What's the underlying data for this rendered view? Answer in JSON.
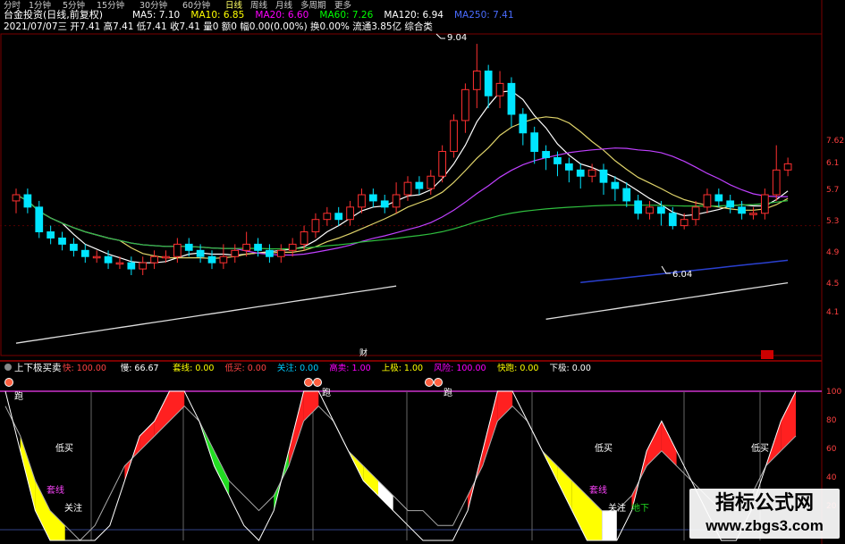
{
  "toolbar": {
    "periods": [
      "分时",
      "1分钟",
      "5分钟",
      "15分钟",
      "30分钟",
      "60分钟",
      "日线",
      "周线",
      "月线",
      "多周期",
      "更多"
    ],
    "active": "日线"
  },
  "main_chart": {
    "title": "台金投资(日线,前复权)",
    "ma_legend": [
      {
        "label": "MA5: 7.10",
        "color": "#ffffff"
      },
      {
        "label": "MA10: 6.85",
        "color": "#ffff00"
      },
      {
        "label": "MA20: 6.60",
        "color": "#ff00ff"
      },
      {
        "label": "MA60: 7.26",
        "color": "#00ff00"
      },
      {
        "label": "MA120: 6.94",
        "color": "#ffffff"
      },
      {
        "label": "MA250: 7.41",
        "color": "#4a6cff"
      }
    ],
    "info_line": "2021/07/07三 开7.41 高7.41 低7.41 收7.41 量0 额0 幅0.00(0.00%) 换0.00% 流通3.85亿 综合类",
    "high_label": "9.04",
    "low_label": "6.04",
    "right_axis": [
      "7.62",
      "6.1",
      "5.7",
      "5.3",
      "4.9",
      "4.5",
      "4.1"
    ],
    "x_axis_label": "财"
  },
  "indicator": {
    "title": "上下极买卖",
    "values": [
      {
        "label": "快: 100.00",
        "color": "#ff4444"
      },
      {
        "label": "慢: 66.67",
        "color": "#ffffff"
      },
      {
        "label": "套线: 0.00",
        "color": "#ffff00"
      },
      {
        "label": "低买: 0.00",
        "color": "#ff4444"
      },
      {
        "label": "关注: 0.00",
        "color": "#00ccff"
      },
      {
        "label": "高卖: 1.00",
        "color": "#ff00ff"
      },
      {
        "label": "上极: 1.00",
        "color": "#ffff00"
      },
      {
        "label": "风险: 100.00",
        "color": "#ff00ff"
      },
      {
        "label": "快跑: 0.00",
        "color": "#ffff00"
      },
      {
        "label": "下极: 0.00",
        "color": "#ffffff"
      }
    ],
    "right_axis": [
      "100",
      "80",
      "60",
      "40",
      "20"
    ],
    "labels": {
      "run": "跑",
      "buy_low": "低买",
      "trap": "套线",
      "watch": "关注",
      "bottom": "地下"
    }
  },
  "watermark": {
    "title": "指标公式网",
    "url": "www.zbgs3.com"
  },
  "chart_data": [
    {
      "type": "candlestick",
      "title": "台金投资(日线,前复权)",
      "candles": [
        {
          "o": 6.5,
          "c": 6.6,
          "h": 6.7,
          "l": 6.3
        },
        {
          "o": 6.6,
          "c": 6.4,
          "h": 6.7,
          "l": 6.3
        },
        {
          "o": 6.4,
          "c": 6.0,
          "h": 6.5,
          "l": 5.9
        },
        {
          "o": 6.0,
          "c": 5.9,
          "h": 6.1,
          "l": 5.8
        },
        {
          "o": 5.9,
          "c": 5.8,
          "h": 6.0,
          "l": 5.7
        },
        {
          "o": 5.8,
          "c": 5.7,
          "h": 5.9,
          "l": 5.6
        },
        {
          "o": 5.7,
          "c": 5.6,
          "h": 5.8,
          "l": 5.5
        },
        {
          "o": 5.6,
          "c": 5.6,
          "h": 5.7,
          "l": 5.5
        },
        {
          "o": 5.6,
          "c": 5.5,
          "h": 5.7,
          "l": 5.4
        },
        {
          "o": 5.5,
          "c": 5.5,
          "h": 5.6,
          "l": 5.4
        },
        {
          "o": 5.5,
          "c": 5.4,
          "h": 5.6,
          "l": 5.3
        },
        {
          "o": 5.4,
          "c": 5.5,
          "h": 5.6,
          "l": 5.3
        },
        {
          "o": 5.5,
          "c": 5.6,
          "h": 5.7,
          "l": 5.4
        },
        {
          "o": 5.6,
          "c": 5.6,
          "h": 5.7,
          "l": 5.5
        },
        {
          "o": 5.6,
          "c": 5.8,
          "h": 5.9,
          "l": 5.5
        },
        {
          "o": 5.8,
          "c": 5.7,
          "h": 5.9,
          "l": 5.6
        },
        {
          "o": 5.7,
          "c": 5.6,
          "h": 5.8,
          "l": 5.5
        },
        {
          "o": 5.6,
          "c": 5.5,
          "h": 5.7,
          "l": 5.4
        },
        {
          "o": 5.5,
          "c": 5.6,
          "h": 5.8,
          "l": 5.4
        },
        {
          "o": 5.6,
          "c": 5.7,
          "h": 5.8,
          "l": 5.5
        },
        {
          "o": 5.7,
          "c": 5.8,
          "h": 6.0,
          "l": 5.6
        },
        {
          "o": 5.8,
          "c": 5.7,
          "h": 5.9,
          "l": 5.6
        },
        {
          "o": 5.7,
          "c": 5.6,
          "h": 5.8,
          "l": 5.5
        },
        {
          "o": 5.6,
          "c": 5.7,
          "h": 5.8,
          "l": 5.5
        },
        {
          "o": 5.7,
          "c": 5.8,
          "h": 5.9,
          "l": 5.6
        },
        {
          "o": 5.8,
          "c": 6.0,
          "h": 6.1,
          "l": 5.7
        },
        {
          "o": 6.0,
          "c": 6.2,
          "h": 6.3,
          "l": 5.9
        },
        {
          "o": 6.2,
          "c": 6.3,
          "h": 6.4,
          "l": 6.1
        },
        {
          "o": 6.3,
          "c": 6.2,
          "h": 6.4,
          "l": 6.1
        },
        {
          "o": 6.2,
          "c": 6.4,
          "h": 6.5,
          "l": 6.1
        },
        {
          "o": 6.4,
          "c": 6.6,
          "h": 6.7,
          "l": 6.3
        },
        {
          "o": 6.6,
          "c": 6.5,
          "h": 6.7,
          "l": 6.4
        },
        {
          "o": 6.5,
          "c": 6.4,
          "h": 6.6,
          "l": 6.3
        },
        {
          "o": 6.4,
          "c": 6.6,
          "h": 6.8,
          "l": 6.3
        },
        {
          "o": 6.6,
          "c": 6.8,
          "h": 6.9,
          "l": 6.5
        },
        {
          "o": 6.8,
          "c": 6.7,
          "h": 6.9,
          "l": 6.6
        },
        {
          "o": 6.7,
          "c": 6.9,
          "h": 7.0,
          "l": 6.6
        },
        {
          "o": 6.9,
          "c": 7.3,
          "h": 7.4,
          "l": 6.8
        },
        {
          "o": 7.3,
          "c": 7.8,
          "h": 7.9,
          "l": 7.2
        },
        {
          "o": 7.8,
          "c": 8.3,
          "h": 8.4,
          "l": 7.6
        },
        {
          "o": 8.3,
          "c": 8.6,
          "h": 9.04,
          "l": 8.0
        },
        {
          "o": 8.6,
          "c": 8.2,
          "h": 8.7,
          "l": 8.0
        },
        {
          "o": 8.2,
          "c": 8.4,
          "h": 8.6,
          "l": 8.0
        },
        {
          "o": 8.4,
          "c": 7.9,
          "h": 8.5,
          "l": 7.7
        },
        {
          "o": 7.9,
          "c": 7.6,
          "h": 8.0,
          "l": 7.4
        },
        {
          "o": 7.6,
          "c": 7.3,
          "h": 7.7,
          "l": 7.1
        },
        {
          "o": 7.3,
          "c": 7.2,
          "h": 7.4,
          "l": 7.0
        },
        {
          "o": 7.2,
          "c": 7.1,
          "h": 7.3,
          "l": 6.9
        },
        {
          "o": 7.1,
          "c": 7.0,
          "h": 7.2,
          "l": 6.8
        },
        {
          "o": 7.0,
          "c": 6.9,
          "h": 7.1,
          "l": 6.7
        },
        {
          "o": 6.9,
          "c": 7.0,
          "h": 7.1,
          "l": 6.8
        },
        {
          "o": 7.0,
          "c": 6.8,
          "h": 7.1,
          "l": 6.6
        },
        {
          "o": 6.8,
          "c": 6.7,
          "h": 6.9,
          "l": 6.5
        },
        {
          "o": 6.7,
          "c": 6.5,
          "h": 6.8,
          "l": 6.4
        },
        {
          "o": 6.5,
          "c": 6.3,
          "h": 6.6,
          "l": 6.2
        },
        {
          "o": 6.3,
          "c": 6.4,
          "h": 6.5,
          "l": 6.2
        },
        {
          "o": 6.4,
          "c": 6.3,
          "h": 6.5,
          "l": 6.1
        },
        {
          "o": 6.3,
          "c": 6.1,
          "h": 6.4,
          "l": 6.04
        },
        {
          "o": 6.1,
          "c": 6.2,
          "h": 6.3,
          "l": 6.04
        },
        {
          "o": 6.2,
          "c": 6.4,
          "h": 6.5,
          "l": 6.1
        },
        {
          "o": 6.4,
          "c": 6.6,
          "h": 6.7,
          "l": 6.3
        },
        {
          "o": 6.6,
          "c": 6.5,
          "h": 6.7,
          "l": 6.4
        },
        {
          "o": 6.5,
          "c": 6.4,
          "h": 6.6,
          "l": 6.3
        },
        {
          "o": 6.4,
          "c": 6.3,
          "h": 6.5,
          "l": 6.2
        },
        {
          "o": 6.3,
          "c": 6.3,
          "h": 6.4,
          "l": 6.2
        },
        {
          "o": 6.3,
          "c": 6.6,
          "h": 6.7,
          "l": 6.2
        },
        {
          "o": 6.6,
          "c": 7.0,
          "h": 7.4,
          "l": 6.5
        },
        {
          "o": 7.0,
          "c": 7.1,
          "h": 7.2,
          "l": 6.9
        }
      ]
    },
    {
      "type": "area",
      "title": "上下极买卖",
      "ylim": [
        0,
        100
      ],
      "series": [
        {
          "name": "快",
          "values": [
            100,
            60,
            20,
            0,
            0,
            0,
            0,
            10,
            40,
            70,
            80,
            100,
            100,
            80,
            50,
            30,
            10,
            0,
            20,
            60,
            100,
            100,
            80,
            60,
            40,
            30,
            20,
            10,
            0,
            0,
            0,
            20,
            60,
            100,
            100,
            80,
            60,
            40,
            20,
            0,
            0,
            0,
            20,
            60,
            80,
            60,
            40,
            20,
            0,
            0,
            20,
            50,
            80,
            100
          ]
        },
        {
          "name": "慢",
          "values": [
            90,
            70,
            40,
            20,
            10,
            0,
            10,
            30,
            50,
            60,
            70,
            80,
            90,
            80,
            60,
            40,
            30,
            20,
            30,
            50,
            80,
            90,
            80,
            60,
            50,
            40,
            30,
            20,
            20,
            10,
            10,
            30,
            50,
            80,
            90,
            80,
            60,
            50,
            40,
            30,
            20,
            20,
            30,
            50,
            60,
            50,
            40,
            30,
            20,
            20,
            30,
            50,
            60,
            70
          ]
        }
      ]
    }
  ]
}
